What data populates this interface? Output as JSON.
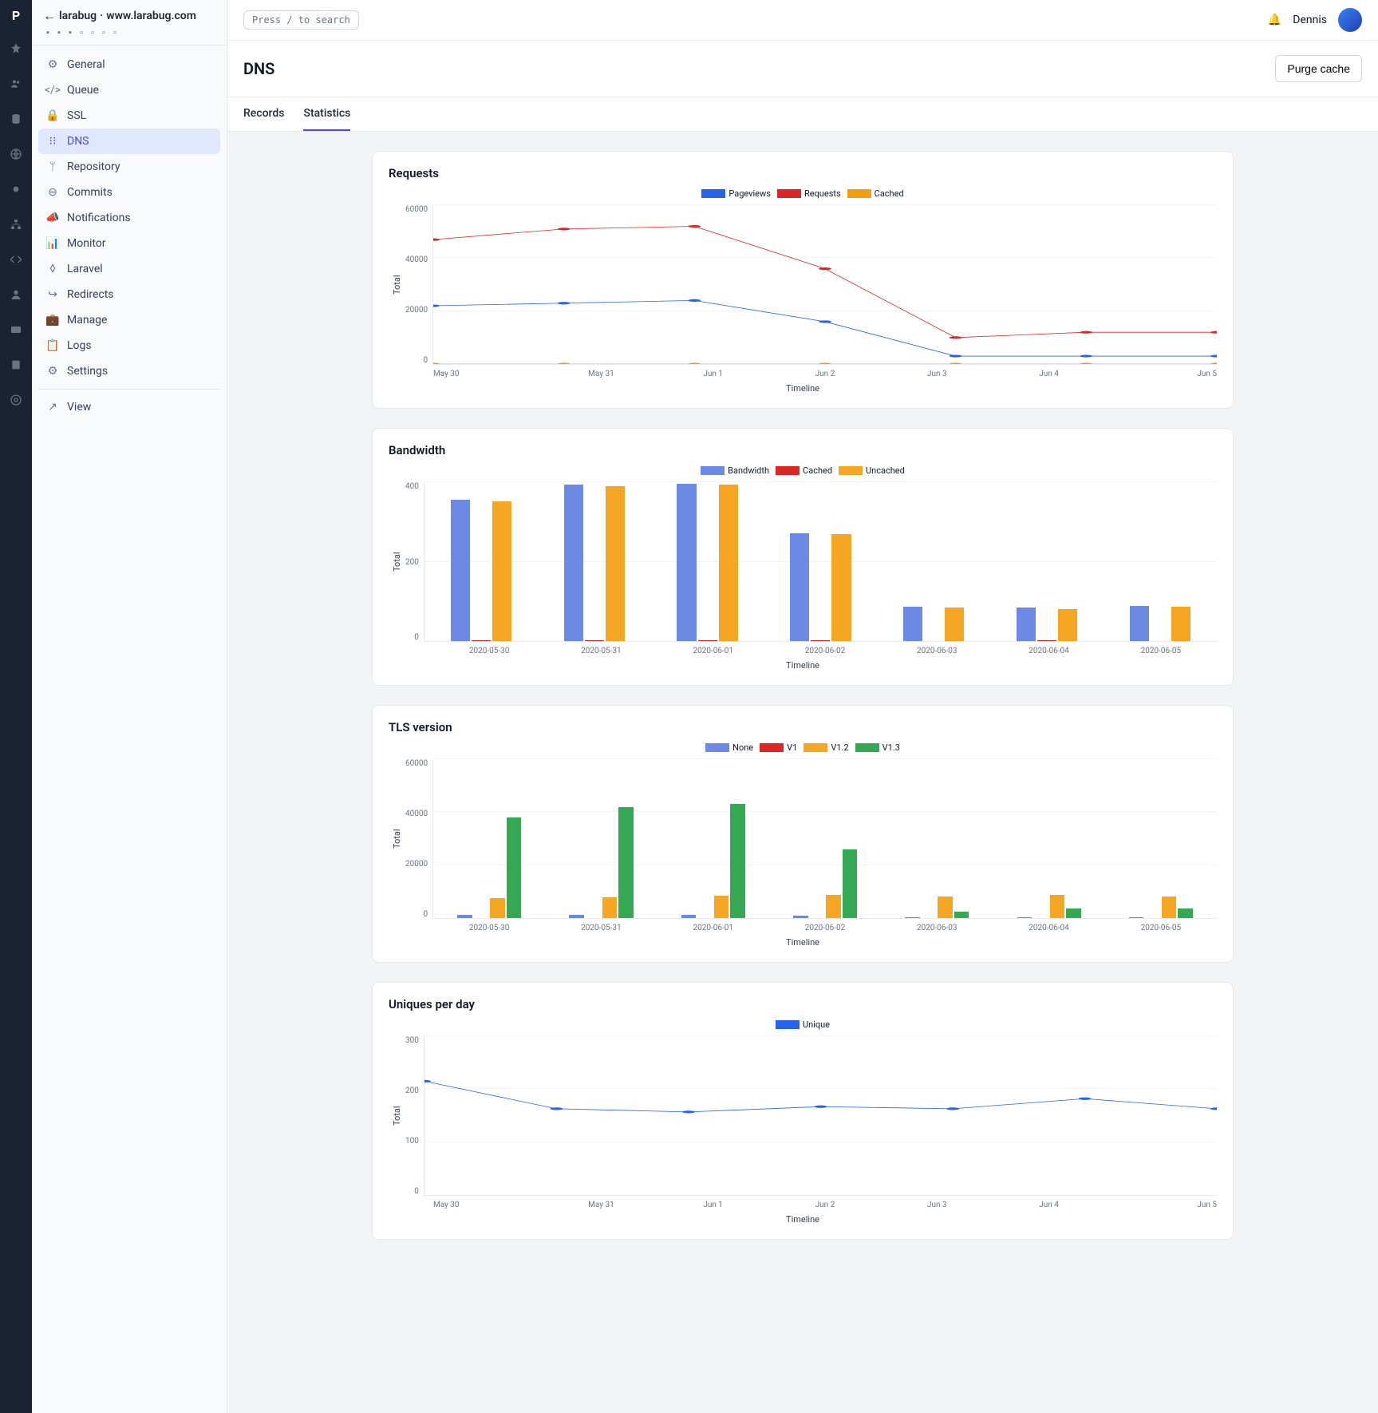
{
  "rail": {
    "logo": "P"
  },
  "sidebar": {
    "back_arrow": "←",
    "title_app": "larabug",
    "title_sep": " · ",
    "title_domain": "www.larabug.com",
    "items": [
      {
        "id": "general",
        "label": "General",
        "icon": "gear"
      },
      {
        "id": "queue",
        "label": "Queue",
        "icon": "code"
      },
      {
        "id": "ssl",
        "label": "SSL",
        "icon": "lock"
      },
      {
        "id": "dns",
        "label": "DNS",
        "icon": "network",
        "active": true
      },
      {
        "id": "repository",
        "label": "Repository",
        "icon": "branch"
      },
      {
        "id": "commits",
        "label": "Commits",
        "icon": "commit"
      },
      {
        "id": "notifications",
        "label": "Notifications",
        "icon": "megaphone"
      },
      {
        "id": "monitor",
        "label": "Monitor",
        "icon": "chart"
      },
      {
        "id": "laravel",
        "label": "Laravel",
        "icon": "laravel"
      },
      {
        "id": "redirects",
        "label": "Redirects",
        "icon": "redirect"
      },
      {
        "id": "manage",
        "label": "Manage",
        "icon": "briefcase"
      },
      {
        "id": "logs",
        "label": "Logs",
        "icon": "clipboard"
      },
      {
        "id": "settings",
        "label": "Settings",
        "icon": "sliders"
      },
      {
        "id": "view",
        "label": "View",
        "icon": "external",
        "divider_before": true
      }
    ]
  },
  "topbar": {
    "search_placeholder": "Press / to search",
    "username": "Dennis"
  },
  "header": {
    "title": "DNS",
    "purge_button": "Purge cache"
  },
  "tabs": [
    {
      "id": "records",
      "label": "Records"
    },
    {
      "id": "statistics",
      "label": "Statistics",
      "active": true
    }
  ],
  "chart_data": [
    {
      "id": "requests",
      "title": "Requests",
      "type": "line",
      "xlabel": "Timeline",
      "ylabel": "Total",
      "ylim": [
        0,
        60000
      ],
      "yticks": [
        0,
        20000,
        40000,
        60000
      ],
      "categories": [
        "May 30",
        "May 31",
        "Jun 1",
        "Jun 2",
        "Jun 3",
        "Jun 4",
        "Jun 5"
      ],
      "series": [
        {
          "name": "Pageviews",
          "color": "#2563eb",
          "values": [
            22000,
            23000,
            24000,
            16000,
            3000,
            3000,
            3000
          ]
        },
        {
          "name": "Requests",
          "color": "#dc2626",
          "values": [
            47000,
            51000,
            52000,
            36000,
            10000,
            12000,
            12000
          ]
        },
        {
          "name": "Cached",
          "color": "#f59e0b",
          "values": [
            0,
            0,
            0,
            0,
            0,
            0,
            0
          ]
        }
      ]
    },
    {
      "id": "bandwidth",
      "title": "Bandwidth",
      "type": "bar",
      "xlabel": "Timeline",
      "ylabel": "Total",
      "ylim": [
        0,
        400
      ],
      "yticks": [
        0,
        200,
        400
      ],
      "categories": [
        "2020-05-30",
        "2020-05-31",
        "2020-06-01",
        "2020-06-02",
        "2020-06-03",
        "2020-06-04",
        "2020-06-05"
      ],
      "series": [
        {
          "name": "Bandwidth",
          "color": "#6c8ae4",
          "values": [
            355,
            393,
            397,
            272,
            86,
            85,
            89
          ]
        },
        {
          "name": "Cached",
          "color": "#dc2626",
          "values": [
            2,
            3,
            3,
            2,
            0,
            2,
            0
          ]
        },
        {
          "name": "Uncached",
          "color": "#f5a623",
          "values": [
            352,
            390,
            395,
            269,
            85,
            81,
            87
          ]
        }
      ]
    },
    {
      "id": "tls",
      "title": "TLS version",
      "type": "bar",
      "xlabel": "Timeline",
      "ylabel": "Total",
      "ylim": [
        0,
        60000
      ],
      "yticks": [
        0,
        20000,
        40000,
        60000
      ],
      "categories": [
        "2020-05-30",
        "2020-05-31",
        "2020-06-01",
        "2020-06-02",
        "2020-06-03",
        "2020-06-04",
        "2020-06-05"
      ],
      "series": [
        {
          "name": "None",
          "color": "#6c8ae4",
          "values": [
            1200,
            1200,
            1200,
            1000,
            400,
            400,
            400
          ]
        },
        {
          "name": "V1",
          "color": "#dc2626",
          "values": [
            0,
            0,
            0,
            0,
            0,
            0,
            0
          ]
        },
        {
          "name": "V1.2",
          "color": "#f5a623",
          "values": [
            7500,
            7800,
            8500,
            8800,
            8100,
            8800,
            8000
          ]
        },
        {
          "name": "V1.3",
          "color": "#34a853",
          "values": [
            38000,
            42000,
            43000,
            26000,
            2500,
            3500,
            3500
          ]
        }
      ]
    },
    {
      "id": "uniques",
      "title": "Uniques per day",
      "type": "line",
      "xlabel": "Timeline",
      "ylabel": "Total",
      "ylim": [
        0,
        300
      ],
      "yticks": [
        0,
        100,
        200,
        300
      ],
      "categories": [
        "May 30",
        "May 31",
        "Jun 1",
        "Jun 2",
        "Jun 3",
        "Jun 4",
        "Jun 5"
      ],
      "series": [
        {
          "name": "Unique",
          "color": "#2563eb",
          "values": [
            215,
            163,
            157,
            167,
            163,
            182,
            163
          ]
        }
      ]
    }
  ]
}
